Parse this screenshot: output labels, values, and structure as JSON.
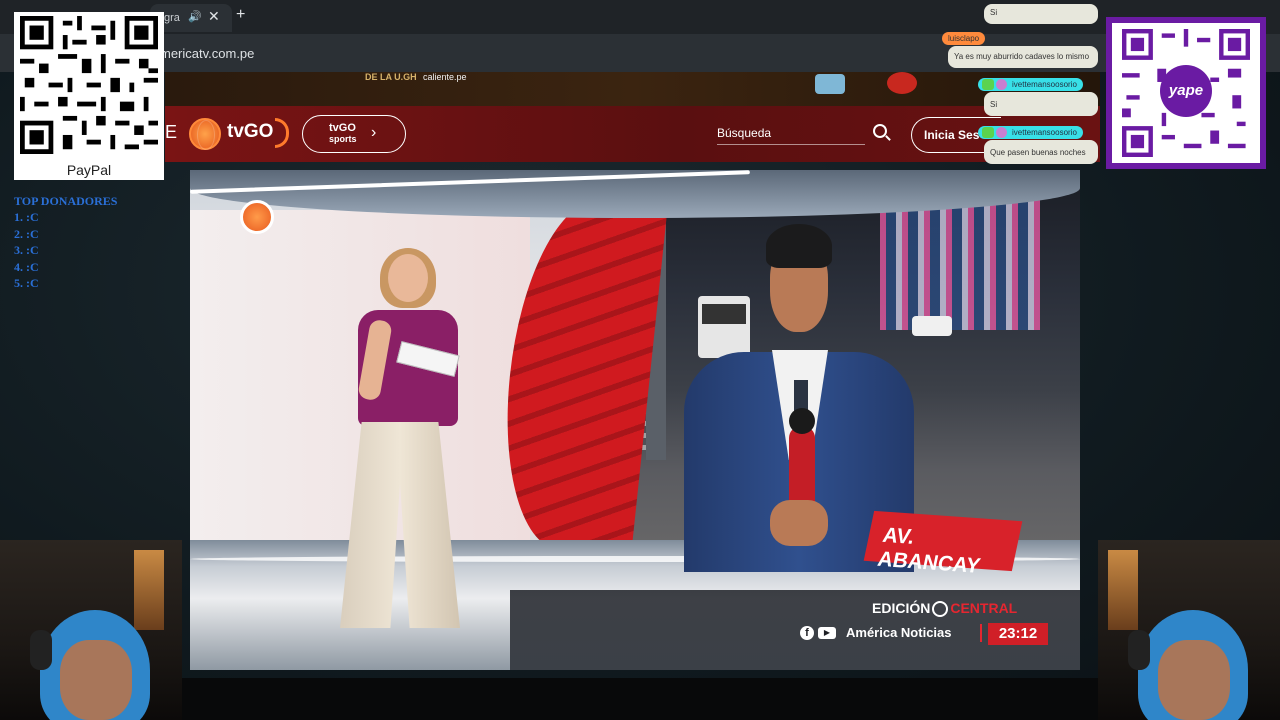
{
  "browser": {
    "tab_title": "gra",
    "url": "mericatv.com.pe"
  },
  "ad_strip": {
    "text_a": "DE LA U.GH",
    "text_b": "caliente.pe"
  },
  "site_nav": {
    "menu_mark": "E",
    "tvgo_label": "tvGO",
    "sports_top": "tvGO",
    "sports_bottom": "sports",
    "sports_arrow": "›",
    "search_label": "Búsqueda",
    "login_label": "Inicia Ses"
  },
  "broadcast": {
    "location": "AV. ABANCAY",
    "edition_prefix": "EDICIÓN",
    "edition_suffix": "CENTRAL",
    "brand": "América Noticias",
    "time": "23:12"
  },
  "overlay_left": {
    "qr_label": "PayPal",
    "donors_title": "TOP DONADORES",
    "donors": [
      "1.  :C",
      "2.  :C",
      "3.  :C",
      "4.  :C",
      "5.  :C"
    ]
  },
  "overlay_right": {
    "yape_label": "yape"
  },
  "chat": [
    {
      "user": "",
      "text": "Si"
    },
    {
      "user": "luisclapo",
      "text": "Ya es muy aburrido cadaves lo mismo"
    },
    {
      "user": "ivettemansoosorio",
      "text": "Si"
    },
    {
      "user": "ivettemansoosorio",
      "text": "Que pasen buenas noches"
    }
  ],
  "colors": {
    "nav_red": "#7a1414",
    "accent_red": "#d01f27",
    "donor_blue": "#2a6fd6",
    "yape_purple": "#6a1ba3"
  }
}
